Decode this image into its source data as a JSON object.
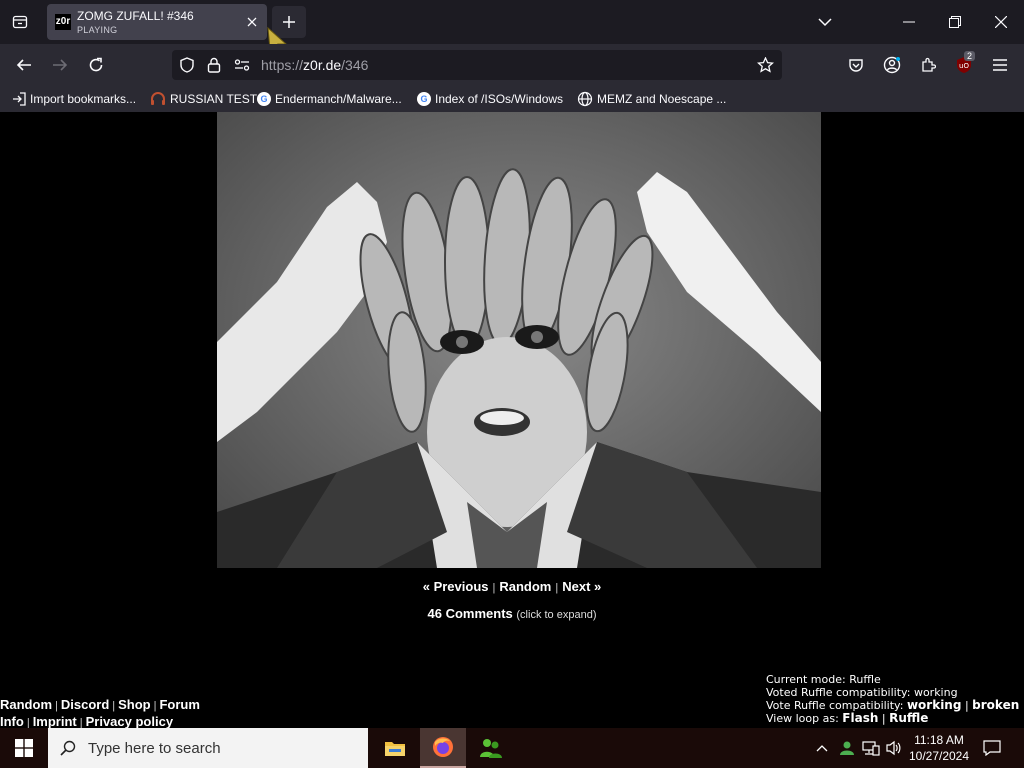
{
  "browser": {
    "tab": {
      "favicon_text": "z0r",
      "title": "ZOMG ZUFALL! #346",
      "status": "PLAYING"
    },
    "address": {
      "scheme": "https://",
      "domain": "z0r.de",
      "path": "/346"
    },
    "notification_badge": "2",
    "bookmarks": [
      {
        "label": "Import bookmarks...",
        "icon": "import-icon"
      },
      {
        "label": "RUSSIAN TEST",
        "icon": "headset-icon"
      },
      {
        "label": "Endermanch/Malware...",
        "icon": "google-icon"
      },
      {
        "label": "Index of /ISOs/Windows",
        "icon": "google-icon"
      },
      {
        "label": "MEMZ and Noescape ...",
        "icon": "globe-icon"
      }
    ]
  },
  "page": {
    "nav": {
      "previous": "« Previous",
      "random": "Random",
      "next": "Next »",
      "sep": "|"
    },
    "comments": {
      "label": "46 Comments",
      "hint": "(click to expand)"
    },
    "footer_links_row1": [
      "Random",
      "Discord",
      "Shop",
      "Forum"
    ],
    "footer_links_row2": [
      "Info",
      "Imprint",
      "Privacy policy"
    ],
    "ruffle": {
      "mode": "Current mode: Ruffle",
      "voted": "Voted Ruffle compatibility: working",
      "vote_label": "Vote Ruffle compatibility:",
      "vote_working": "working",
      "vote_broken": "broken",
      "loop_label": "View loop as:",
      "loop_flash": "Flash",
      "loop_ruffle": "Ruffle"
    }
  },
  "taskbar": {
    "search_placeholder": "Type here to search",
    "time": "11:18 AM",
    "date": "10/27/2024"
  },
  "colors": {
    "tabbar_bg": "#1c1b22",
    "toolbar_bg": "#2b2a33",
    "page_bg": "#000000",
    "taskbar_bg": "#1a0a08"
  }
}
